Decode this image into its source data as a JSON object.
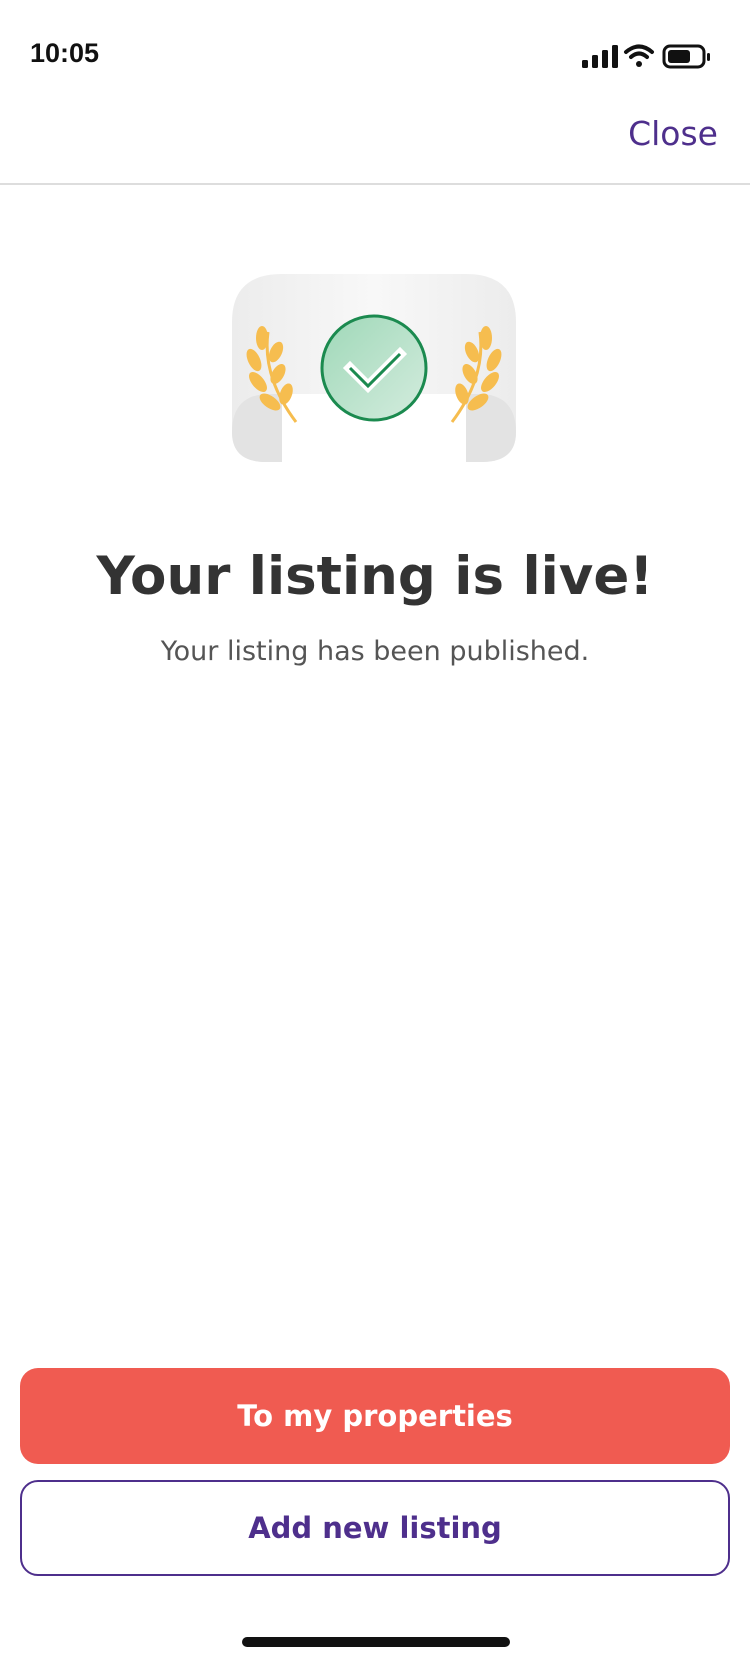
{
  "status_bar": {
    "time": "10:05",
    "icons": [
      "cellular-signal-icon",
      "wifi-icon",
      "battery-icon"
    ]
  },
  "header": {
    "close_label": "Close"
  },
  "main": {
    "illustration_icons": [
      "laurel-left-icon",
      "checkmark-icon",
      "laurel-right-icon"
    ],
    "title": "Your listing is live!",
    "subtitle": "Your listing has been published."
  },
  "actions": {
    "primary_label": "To my properties",
    "secondary_label": "Add new listing"
  },
  "colors": {
    "accent_purple": "#4e2f8c",
    "primary_button": "#f05b51",
    "success_green": "#1b8a4f",
    "laurel_gold": "#f6bd4f"
  }
}
